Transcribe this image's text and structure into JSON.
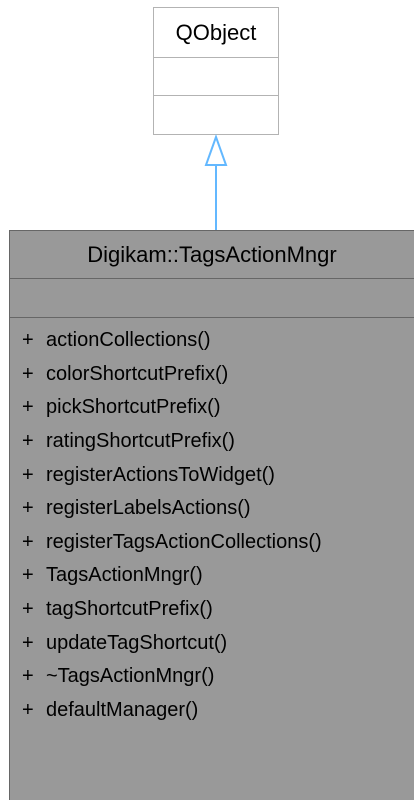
{
  "parent_class": {
    "name": "QObject"
  },
  "class": {
    "name": "Digikam::TagsActionMngr",
    "methods": [
      {
        "vis": "+",
        "name": "actionCollections()"
      },
      {
        "vis": "+",
        "name": "colorShortcutPrefix()"
      },
      {
        "vis": "+",
        "name": "pickShortcutPrefix()"
      },
      {
        "vis": "+",
        "name": "ratingShortcutPrefix()"
      },
      {
        "vis": "+",
        "name": "registerActionsToWidget()"
      },
      {
        "vis": "+",
        "name": "registerLabelsActions()"
      },
      {
        "vis": "+",
        "name": "registerTagsActionCollections()"
      },
      {
        "vis": "+",
        "name": "TagsActionMngr()"
      },
      {
        "vis": "+",
        "name": "tagShortcutPrefix()"
      },
      {
        "vis": "+",
        "name": "updateTagShortcut()"
      },
      {
        "vis": "+",
        "name": "~TagsActionMngr()"
      },
      {
        "vis": "+",
        "name": "defaultManager()"
      }
    ]
  },
  "colors": {
    "inheritance_arrow": "#63b8ff",
    "class_fill": "#999999",
    "class_border": "#666666",
    "parent_border": "#b3b3b3"
  }
}
